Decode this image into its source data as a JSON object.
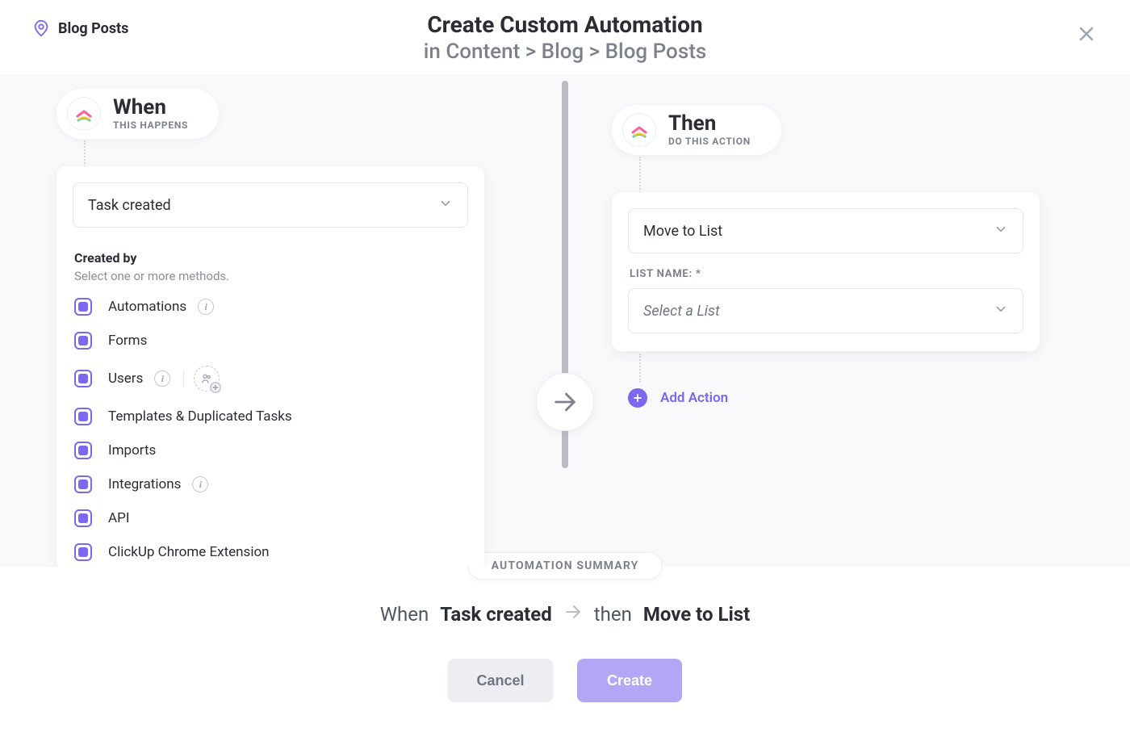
{
  "header": {
    "crumb_label": "Blog Posts",
    "title": "Create Custom Automation",
    "subtitle": "in Content > Blog > Blog Posts"
  },
  "when": {
    "title": "When",
    "subtitle": "THIS HAPPENS",
    "trigger_selected": "Task created",
    "created_by": {
      "title": "Created by",
      "subtitle": "Select one or more methods.",
      "items": [
        {
          "label": "Automations",
          "checked": true,
          "info": true
        },
        {
          "label": "Forms",
          "checked": true
        },
        {
          "label": "Users",
          "checked": true,
          "info": true,
          "users_extra": true
        },
        {
          "label": "Templates & Duplicated Tasks",
          "checked": true
        },
        {
          "label": "Imports",
          "checked": true
        },
        {
          "label": "Integrations",
          "checked": true,
          "info": true
        },
        {
          "label": "API",
          "checked": true
        },
        {
          "label": "ClickUp Chrome Extension",
          "checked": true
        }
      ]
    }
  },
  "then": {
    "title": "Then",
    "subtitle": "DO THIS ACTION",
    "action_selected": "Move to List",
    "field_label": "LIST NAME: *",
    "field_placeholder": "Select a List",
    "add_action_label": "Add Action"
  },
  "footer": {
    "summary_label": "AUTOMATION SUMMARY",
    "when_prefix": "When",
    "when_value": "Task created",
    "then_prefix": "then",
    "then_value": "Move to List",
    "cancel": "Cancel",
    "create": "Create"
  }
}
